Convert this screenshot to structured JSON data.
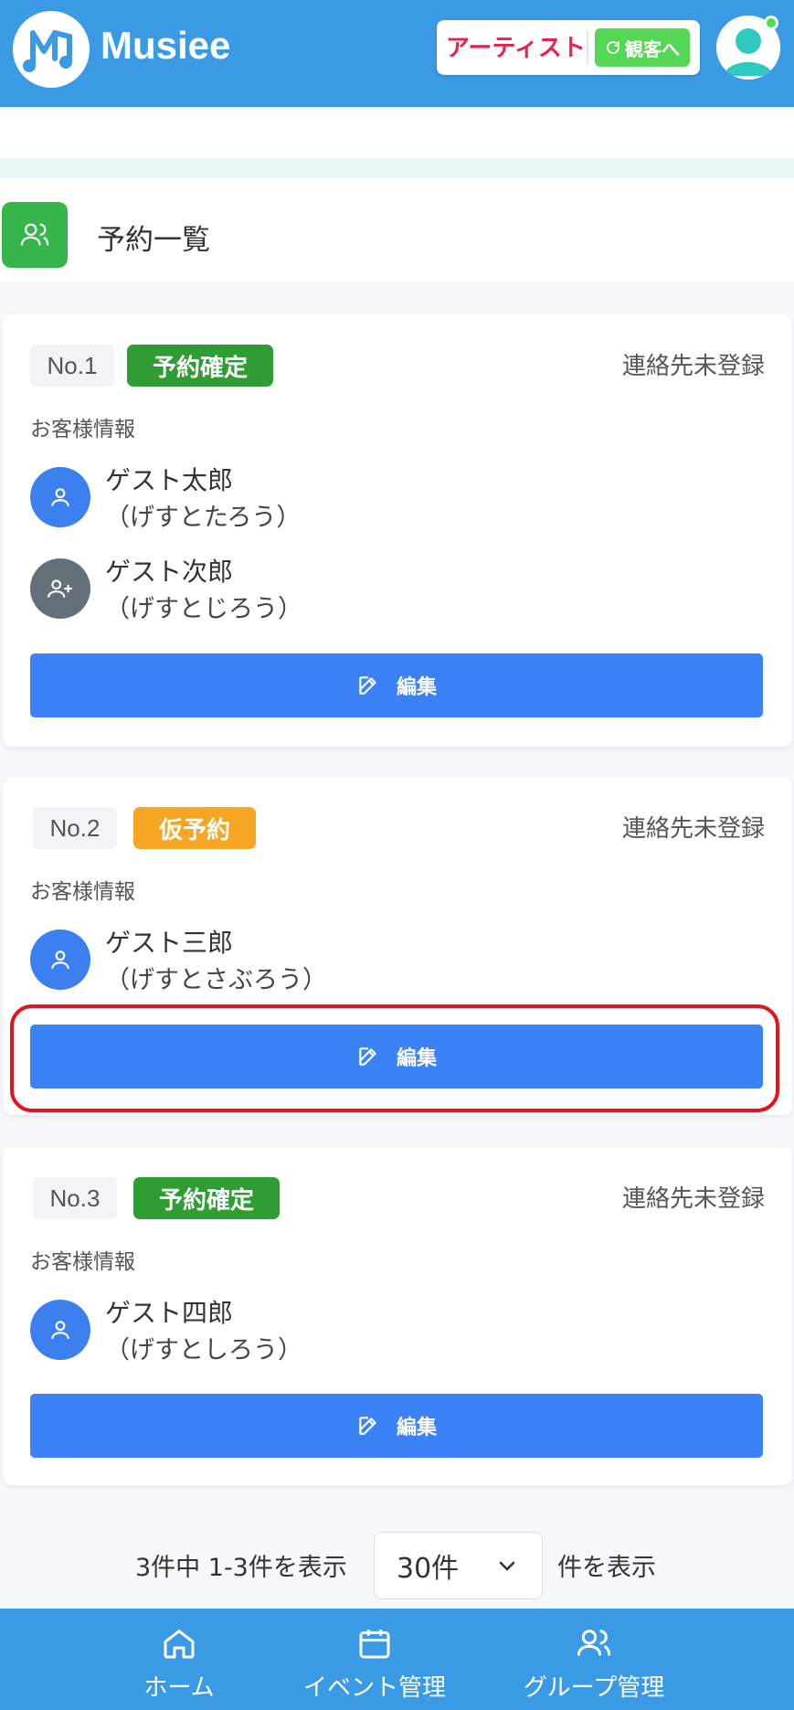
{
  "header": {
    "brand": "Musiee",
    "role_current": "アーティスト",
    "role_switch_label": "観客へ",
    "colors": {
      "bar": "#3a9be4",
      "artist": "#e8214e",
      "switch": "#55d655"
    }
  },
  "page": {
    "title": "予約一覧"
  },
  "reservations": [
    {
      "no": "No.1",
      "status": "予約確定",
      "status_color": "#2f9d34",
      "contact": "連絡先未登録",
      "section_label": "お客様情報",
      "guests": [
        {
          "name": "ゲスト太郎",
          "kana": "（げすとたろう）",
          "icon": "user-icon"
        },
        {
          "name": "ゲスト次郎",
          "kana": "（げすとじろう）",
          "icon": "user-plus-icon"
        }
      ],
      "edit_label": "編集"
    },
    {
      "no": "No.2",
      "status": "仮予約",
      "status_color": "#f6a623",
      "contact": "連絡先未登録",
      "section_label": "お客様情報",
      "guests": [
        {
          "name": "ゲスト三郎",
          "kana": "（げすとさぶろう）",
          "icon": "user-icon"
        }
      ],
      "edit_label": "編集"
    },
    {
      "no": "No.3",
      "status": "予約確定",
      "status_color": "#2f9d34",
      "contact": "連絡先未登録",
      "section_label": "お客様情報",
      "guests": [
        {
          "name": "ゲスト四郎",
          "kana": "（げすとしろう）",
          "icon": "user-icon"
        }
      ],
      "edit_label": "編集"
    }
  ],
  "pagination": {
    "summary": "3件中 1-3件を表示",
    "per_page_value": "30件",
    "suffix": "件を表示"
  },
  "bottom_nav": [
    {
      "label": "ホーム",
      "icon": "home-icon"
    },
    {
      "label": "イベント管理",
      "icon": "calendar-icon"
    },
    {
      "label": "グループ管理",
      "icon": "group-icon"
    }
  ]
}
